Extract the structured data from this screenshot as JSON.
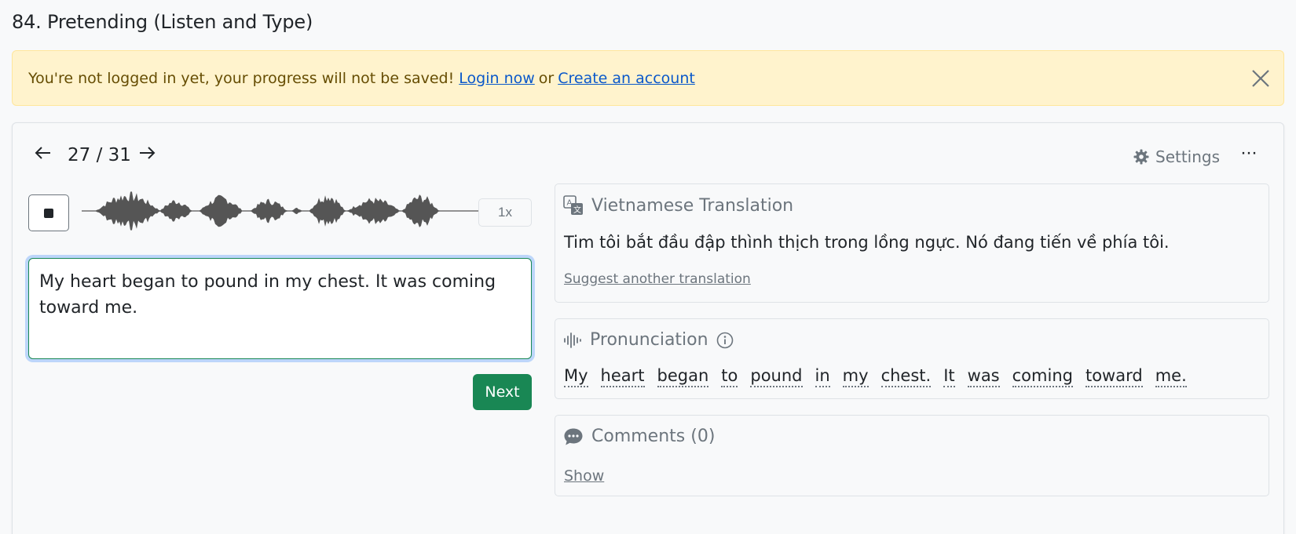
{
  "page": {
    "title": "84. Pretending (Listen and Type)"
  },
  "alert": {
    "message": "You're not logged in yet, your progress will not be saved!",
    "login_link": "Login now",
    "separator": "or",
    "create_link": "Create an account"
  },
  "player": {
    "counter": "27 / 31",
    "prev_icon": "arrow-left-icon",
    "next_icon": "arrow-right-icon",
    "settings_label": "Settings",
    "more_label": "···",
    "speed_label": "1x",
    "stop_icon": "stop-icon"
  },
  "answer": {
    "value": "My heart began to pound in my chest. It was coming toward me."
  },
  "next_button": "Next",
  "translation": {
    "heading": "Vietnamese Translation",
    "text": "Tim tôi bắt đầu đập thình thịch trong lồng ngực. Nó đang tiến về phía tôi.",
    "suggest_link": "Suggest another translation"
  },
  "pronunciation": {
    "heading": "Pronunciation",
    "words": [
      "My",
      "heart",
      "began",
      "to",
      "pound",
      "in",
      "my",
      "chest.",
      "It",
      "was",
      "coming",
      "toward",
      "me."
    ]
  },
  "comments": {
    "heading": "Comments (0)",
    "show_link": "Show"
  },
  "colors": {
    "accent_green": "#198754",
    "alert_bg": "#fff3cd",
    "link_blue": "#0a58ca",
    "muted": "#6c757d"
  }
}
